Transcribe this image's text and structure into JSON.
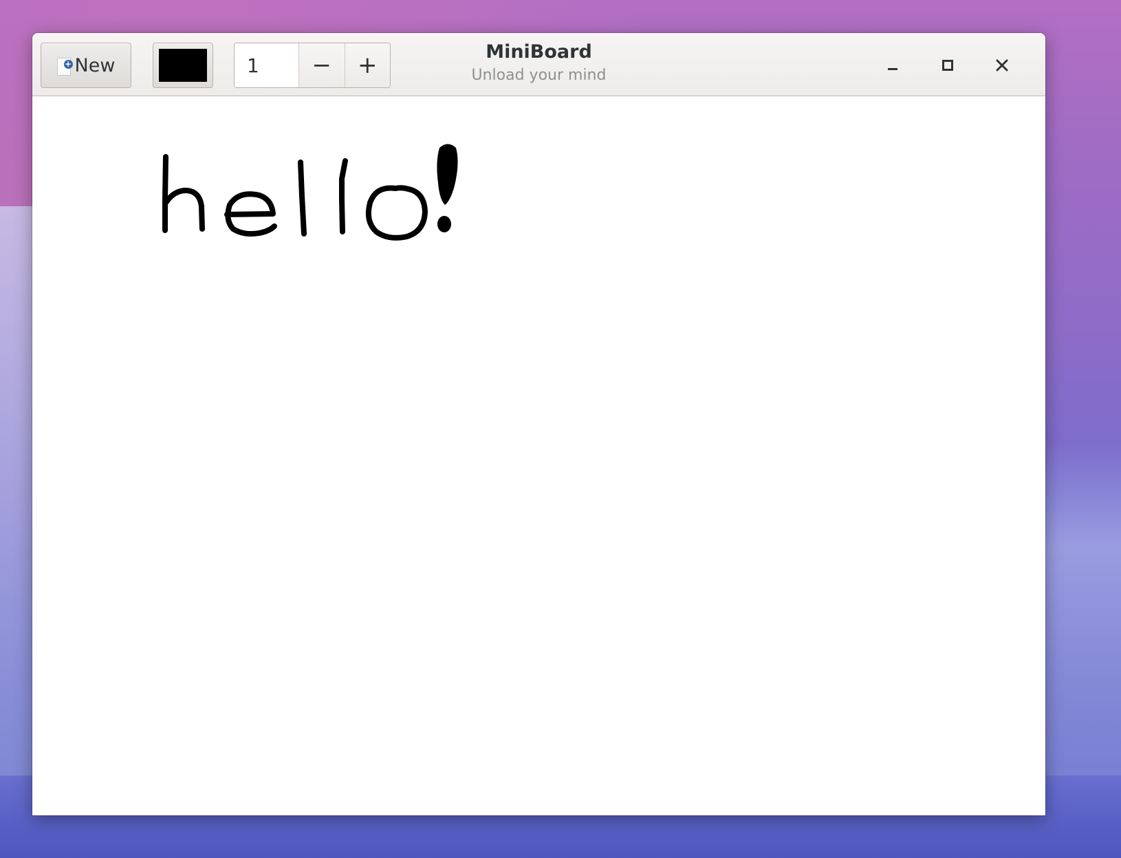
{
  "window": {
    "title": "MiniBoard",
    "subtitle": "Unload your mind"
  },
  "toolbar": {
    "new_label": "New",
    "new_icon": "document-new-icon",
    "pen_color": "#000000",
    "pen_size": "1",
    "decrease_label": "−",
    "increase_label": "+"
  },
  "window_controls": {
    "minimize_icon": "minimize-icon",
    "maximize_icon": "maximize-icon",
    "close_icon": "close-icon"
  },
  "canvas": {
    "background": "#ffffff",
    "handwriting": "hello!",
    "stroke_color": "#000000"
  }
}
